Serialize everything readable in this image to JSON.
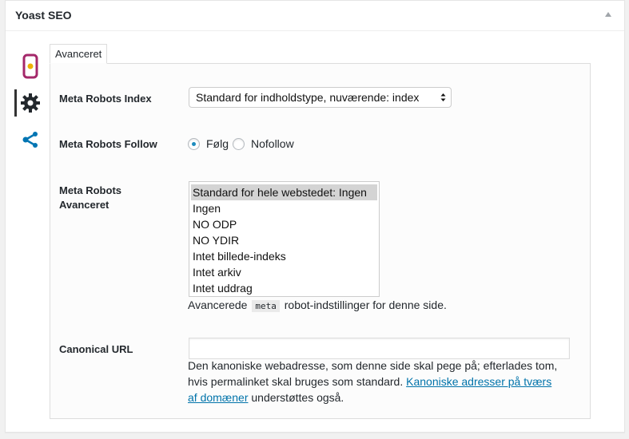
{
  "metabox": {
    "title": "Yoast SEO"
  },
  "sidebar": {
    "tabs": [
      {
        "icon": "traffic-light-icon"
      },
      {
        "icon": "gear-icon",
        "active": true
      },
      {
        "icon": "share-icon"
      }
    ]
  },
  "tab": {
    "label": "Avanceret"
  },
  "fields": {
    "meta_robots_index": {
      "label": "Meta Robots Index",
      "selected": "Standard for indholdstype, nuværende: index"
    },
    "meta_robots_follow": {
      "label": "Meta Robots Follow",
      "options": [
        {
          "label": "Følg",
          "checked": true
        },
        {
          "label": "Nofollow",
          "checked": false
        }
      ]
    },
    "meta_robots_advanced": {
      "label_line1": "Meta Robots",
      "label_line2": "Avanceret",
      "options": [
        "Standard for hele webstedet: Ingen",
        "Ingen",
        "NO ODP",
        "NO YDIR",
        "Intet billede-indeks",
        "Intet arkiv",
        "Intet uddrag"
      ],
      "selected_index": 0,
      "help_before": "Avancerede",
      "help_code": "meta",
      "help_after": "robot-indstillinger for denne side."
    },
    "canonical_url": {
      "label": "Canonical URL",
      "value": "",
      "help_line1": "Den kanoniske webadresse, som denne side skal pege på; efterlades tom,",
      "help_line2_before": "hvis permalinket skal bruges som standard.",
      "help_link_part1": "Kanoniske adresser på tværs",
      "help_link_part2": "af domæner",
      "help_after": "understøttes også."
    }
  },
  "colors": {
    "accent": "#0073aa",
    "radio_checked": "#1e8cbe",
    "traffic_light_border": "#a4286a",
    "traffic_light_dot": "#eeb000",
    "share_icon": "#0075b3"
  }
}
